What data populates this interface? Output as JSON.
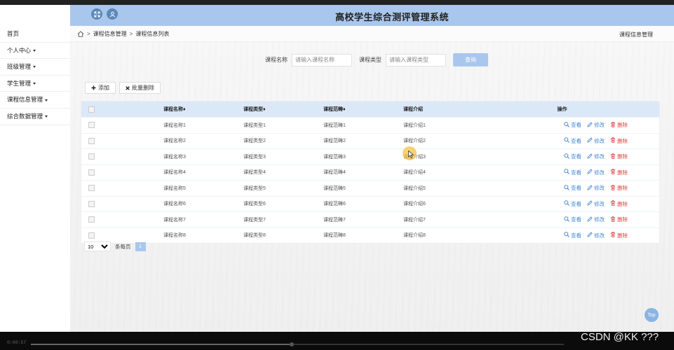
{
  "app": {
    "title": "高校学生综合测评管理系统"
  },
  "header": {
    "left_icons": [
      "expand-icon",
      "user-icon"
    ]
  },
  "sidebar": {
    "items": [
      {
        "label": "首页",
        "has_caret": false
      },
      {
        "label": "个人中心",
        "has_caret": true
      },
      {
        "label": "班级管理",
        "has_caret": true
      },
      {
        "label": "学生管理",
        "has_caret": true
      },
      {
        "label": "课程信息管理",
        "has_caret": true
      },
      {
        "label": "综合数据管理",
        "has_caret": true
      }
    ]
  },
  "breadcrumb": {
    "sep": ">",
    "items": [
      "课程信息管理",
      "课程信息列表"
    ],
    "right": "课程信息管理"
  },
  "search": {
    "name_label": "课程名称",
    "name_placeholder": "请输入课程名称",
    "type_label": "课程类型",
    "type_placeholder": "请输入课程类型",
    "button_label": "查询"
  },
  "actions": {
    "add_label": "添加",
    "batch_delete_label": "批量删除"
  },
  "table": {
    "columns": [
      "课程名称",
      "课程类型",
      "课程范畴",
      "课程介绍",
      "操作"
    ],
    "sort_mark": "♦",
    "rows": [
      [
        "课程名称1",
        "课程类型1",
        "课程范畴1",
        "课程介绍1"
      ],
      [
        "课程名称2",
        "课程类型2",
        "课程范畴2",
        "课程介绍2"
      ],
      [
        "课程名称3",
        "课程类型3",
        "课程范畴3",
        "课程介绍3"
      ],
      [
        "课程名称4",
        "课程类型4",
        "课程范畴4",
        "课程介绍4"
      ],
      [
        "课程名称5",
        "课程类型5",
        "课程范畴5",
        "课程介绍5"
      ],
      [
        "课程名称6",
        "课程类型6",
        "课程范畴6",
        "课程介绍6"
      ],
      [
        "课程名称7",
        "课程类型7",
        "课程范畴7",
        "课程介绍7"
      ],
      [
        "课程名称8",
        "课程类型8",
        "课程范畴8",
        "课程介绍8"
      ]
    ],
    "row_actions": {
      "view": "查看",
      "edit": "修改",
      "delete": "删除"
    }
  },
  "pagination": {
    "page_size": "10",
    "per_page_label": "条每页",
    "current_page": "1"
  },
  "back_to_top": "Top",
  "video": {
    "time": "0:00:57",
    "progress": 0.49
  },
  "watermark": "CSDN @KK ???",
  "colors": {
    "accent": "#a9c7ec",
    "header": "#a9c7ec",
    "link": "#4a8ad4",
    "danger": "#e04040"
  }
}
